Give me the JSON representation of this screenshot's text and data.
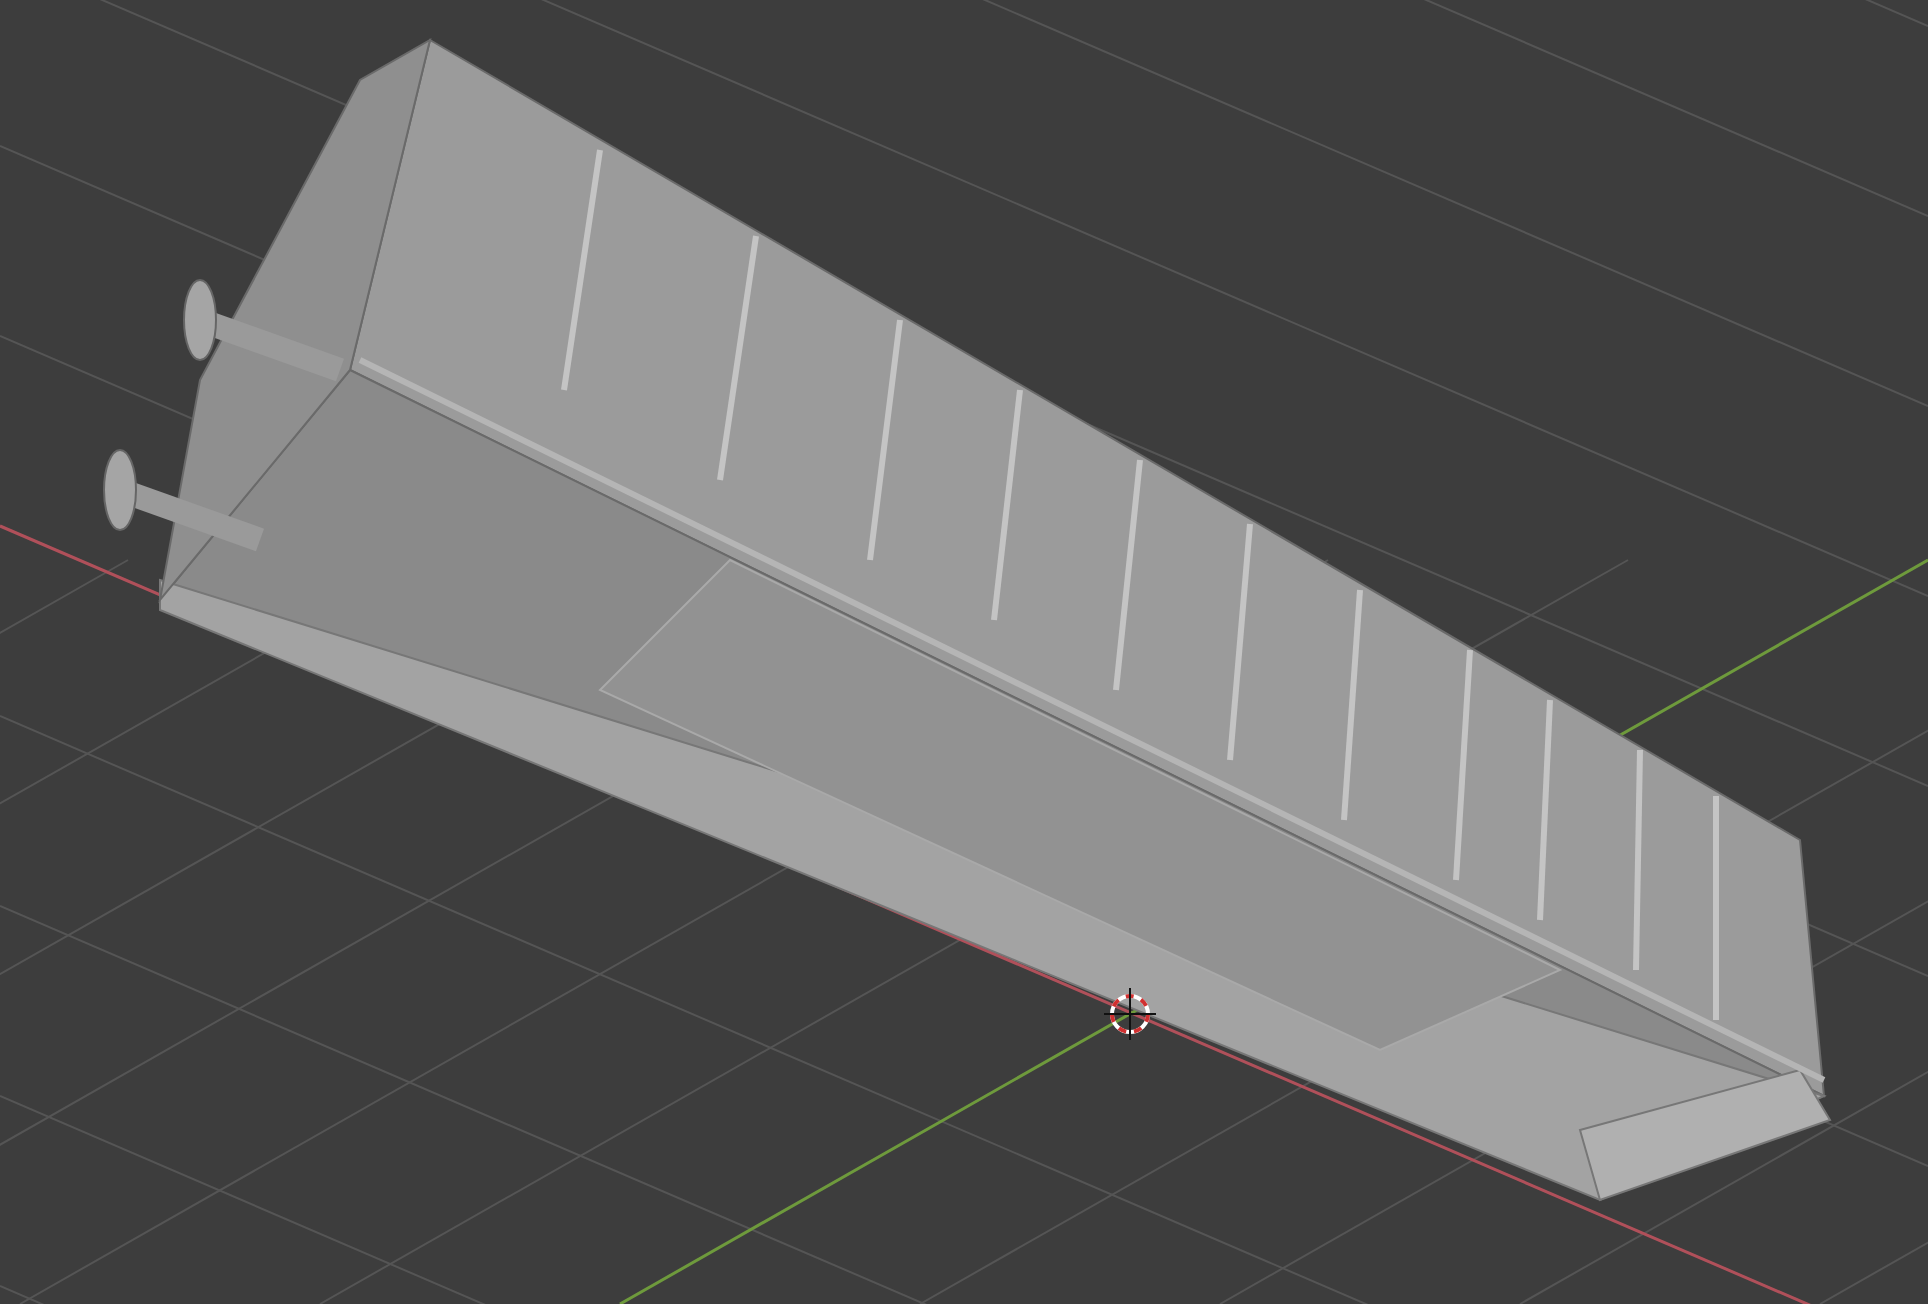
{
  "viewport": {
    "grid": true,
    "x_axis": true,
    "y_axis": true,
    "cursor_3d": true
  }
}
